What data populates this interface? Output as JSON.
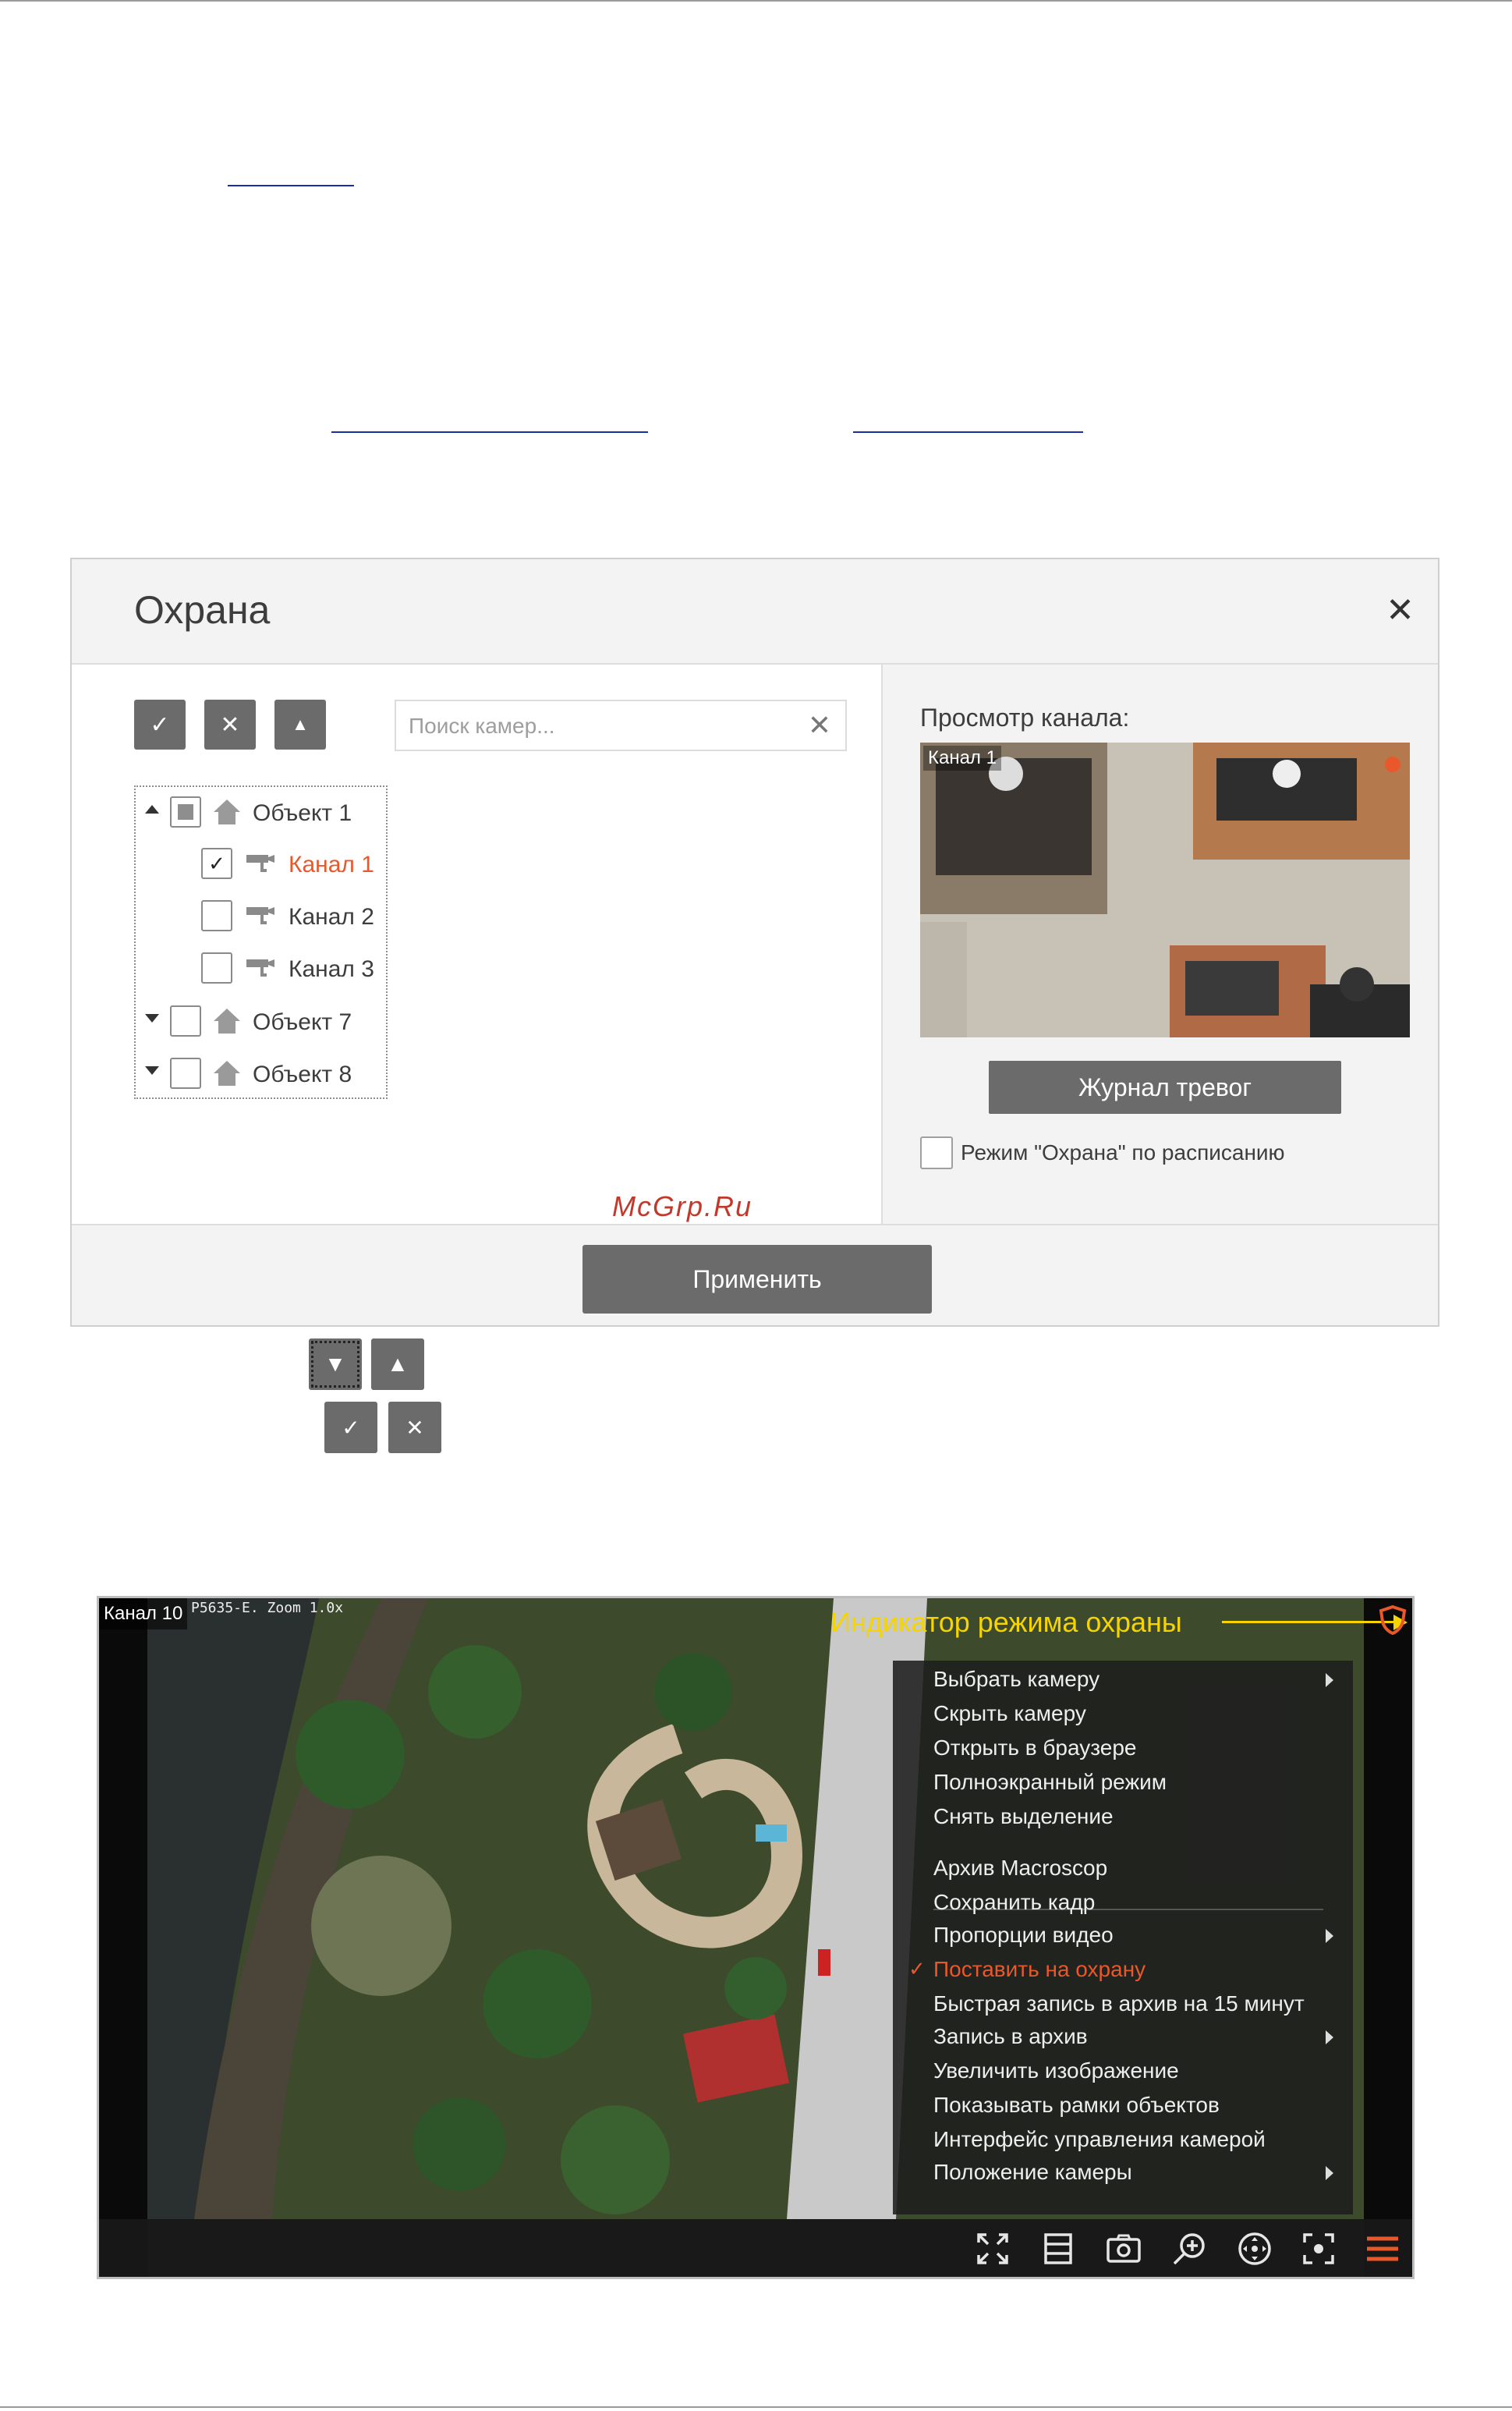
{
  "dialog": {
    "title": "Охрана",
    "toolbar": {
      "check_all": "✓",
      "uncheck_all": "✕",
      "collapse": "▲"
    },
    "search": {
      "placeholder": "Поиск камер...",
      "value": "",
      "clear": "✕"
    },
    "tree": [
      {
        "label": "Объект 1",
        "type": "object",
        "expanded": true,
        "state": "partial"
      },
      {
        "label": "Канал 1",
        "type": "channel",
        "state": "checked",
        "active": true
      },
      {
        "label": "Канал 2",
        "type": "channel",
        "state": "unchecked"
      },
      {
        "label": "Канал 3",
        "type": "channel",
        "state": "unchecked"
      },
      {
        "label": "Объект 7",
        "type": "object",
        "expanded": false,
        "state": "unchecked"
      },
      {
        "label": "Объект 8",
        "type": "object",
        "expanded": false,
        "state": "unchecked"
      }
    ],
    "preview": {
      "label": "Просмотр канала:",
      "channel_tag": "Канал 1"
    },
    "alarm_log_button": "Журнал тревог",
    "schedule_label": "Режим \"Охрана\" по расписанию",
    "apply_button": "Применить",
    "watermark": "McGrp.Ru"
  },
  "legend_buttons": {
    "expand": "▼",
    "collapse": "▲",
    "check": "✓",
    "uncheck": "✕"
  },
  "camera_view": {
    "channel_tag": "Канал 10",
    "info_overlay": "P5635-E. Zoom 1.0x",
    "indicator_label": "Индикатор режима охраны",
    "context_menu": [
      {
        "label": "Выбрать камеру",
        "submenu": true
      },
      {
        "label": "Скрыть камеру"
      },
      {
        "label": "Открыть в браузере"
      },
      {
        "label": "Полноэкранный режим"
      },
      {
        "label": "Снять выделение"
      },
      {
        "label": "Архив Macroscop"
      },
      {
        "label": "Сохранить кадр"
      },
      {
        "label": "Пропорции видео",
        "submenu": true
      },
      {
        "label": "Поставить на охрану",
        "checked": true,
        "active": true
      },
      {
        "label": "Быстрая запись в архив на 15 минут"
      },
      {
        "label": "Запись в архив",
        "submenu": true
      },
      {
        "label": "Увеличить изображение"
      },
      {
        "label": "Показывать рамки объектов"
      },
      {
        "label": "Интерфейс управления камерой"
      },
      {
        "label": "Положение камеры",
        "submenu": true
      }
    ],
    "toolbar_icons": [
      "fullscreen-icon",
      "layout-icon",
      "snapshot-icon",
      "zoom-in-icon",
      "ptz-icon",
      "focus-icon",
      "menu-icon"
    ]
  },
  "colors": {
    "accent": "#e9582a",
    "button": "#6b6b6b",
    "indicator": "#f5d400",
    "link": "#1a2ea8"
  }
}
